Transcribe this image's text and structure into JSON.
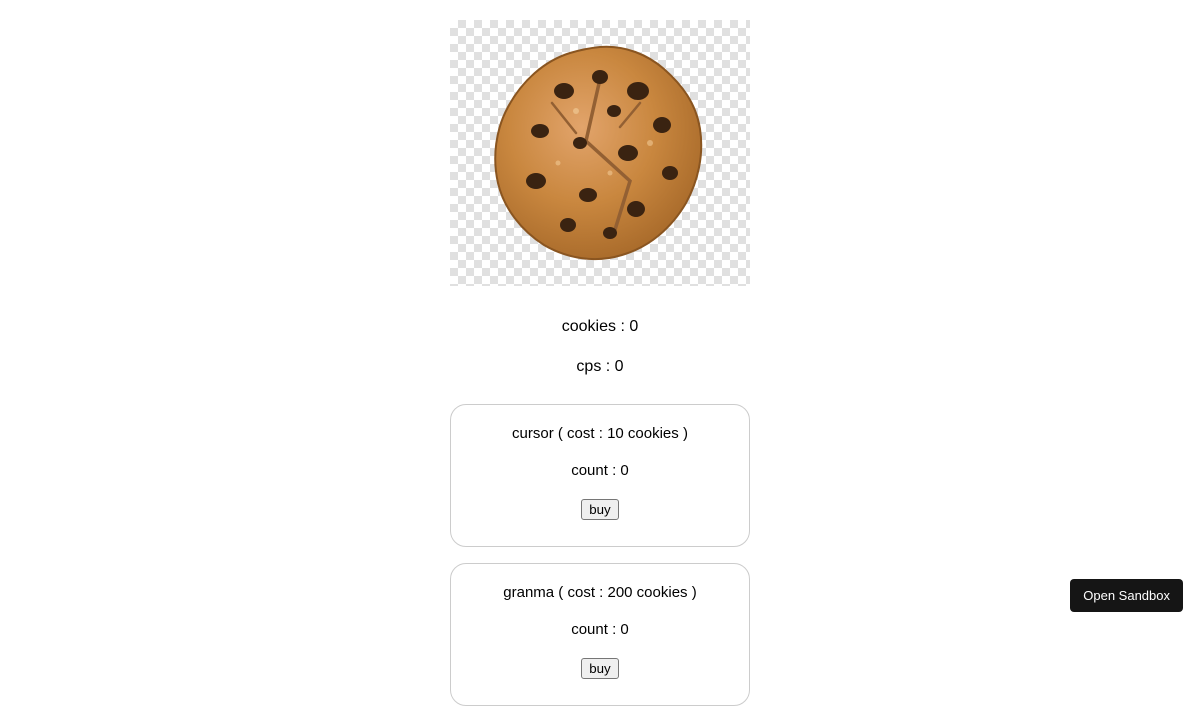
{
  "stats": {
    "cookies_label": "cookies : 0",
    "cps_label": "cps : 0"
  },
  "shop": [
    {
      "title": "cursor ( cost : 10 cookies )",
      "count": "count : 0",
      "buy_label": "buy"
    },
    {
      "title": "granma ( cost : 200 cookies )",
      "count": "count : 0",
      "buy_label": "buy"
    }
  ],
  "sandbox_button": "Open Sandbox"
}
